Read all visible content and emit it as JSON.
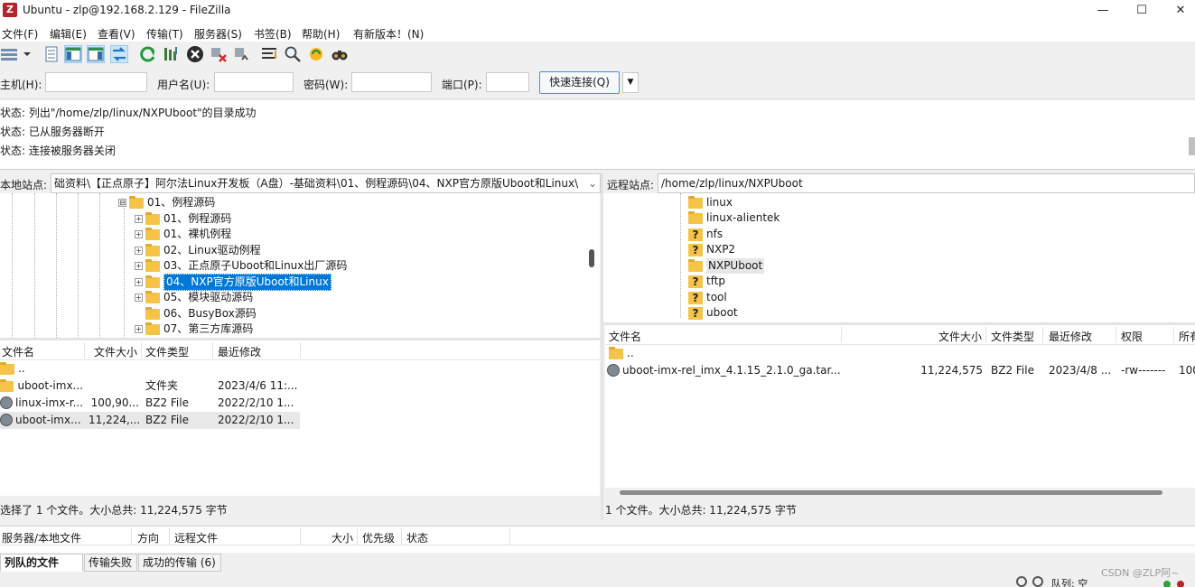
{
  "window": {
    "title": "Ubuntu - zlp@192.168.2.129 - FileZilla",
    "app_icon": "Z",
    "minimize": "—",
    "maximize": "☐",
    "close": "✕"
  },
  "menu": [
    "文件(F)",
    "编辑(E)",
    "查看(V)",
    "传输(T)",
    "服务器(S)",
    "书签(B)",
    "帮助(H)",
    "有新版本！(N)"
  ],
  "quickconnect": {
    "host_label": "主机(H):",
    "user_label": "用户名(U):",
    "pass_label": "密码(W):",
    "port_label": "端口(P):",
    "host": "",
    "user": "",
    "pass": "",
    "port": "",
    "button": "快速连接(Q)",
    "dropdown": "▼"
  },
  "log": [
    "状态:  列出\"/home/zlp/linux/NXPUboot\"的目录成功",
    "状态:  已从服务器断开",
    "状态:  连接被服务器关闭"
  ],
  "local": {
    "site_label": "本地站点:",
    "path": "础资料\\【正点原子】阿尔法Linux开发板（A盘）-基础资料\\01、例程源码\\04、NXP官方原版Uboot和Linux\\",
    "tree": [
      {
        "label": "01、例程源码",
        "expander": "⊟"
      },
      {
        "label": "01、例程源码",
        "expander": "+"
      },
      {
        "label": "01、裸机例程",
        "expander": "+"
      },
      {
        "label": "02、Linux驱动例程",
        "expander": "+"
      },
      {
        "label": "03、正点原子Uboot和Linux出厂源码",
        "expander": "+"
      },
      {
        "label": "04、NXP官方原版Uboot和Linux",
        "expander": "+",
        "selected": true
      },
      {
        "label": "05、模块驱动源码",
        "expander": "+"
      },
      {
        "label": "06、BusyBox源码",
        "expander": ""
      },
      {
        "label": "07、第三方库源码",
        "expander": "+"
      }
    ],
    "headers": [
      "文件名",
      "文件大小",
      "文件类型",
      "最近修改"
    ],
    "sort_arrow": "^",
    "files": [
      {
        "name": "..",
        "size": "",
        "type": "",
        "modified": "",
        "icon": "folder-icon"
      },
      {
        "name": "uboot-imx...",
        "size": "",
        "type": "文件夹",
        "modified": "2023/4/6 11:...",
        "icon": "folder-icon"
      },
      {
        "name": "linux-imx-r...",
        "size": "100,90...",
        "type": "BZ2 File",
        "modified": "2022/2/10 1...",
        "icon": "archive-icon"
      },
      {
        "name": "uboot-imx...",
        "size": "11,224,...",
        "type": "BZ2 File",
        "modified": "2022/2/10 1...",
        "icon": "archive-icon",
        "selected": true
      }
    ],
    "status": "选择了 1 个文件。大小总共: 11,224,575 字节"
  },
  "remote": {
    "site_label": "远程站点:",
    "path": "/home/zlp/linux/NXPUboot",
    "tree": [
      {
        "label": "linux",
        "icon": "folder"
      },
      {
        "label": "linux-alientek",
        "icon": "folder"
      },
      {
        "label": "nfs",
        "icon": "unknown"
      },
      {
        "label": "NXP2",
        "icon": "unknown"
      },
      {
        "label": "NXPUboot",
        "icon": "folder",
        "selected": true
      },
      {
        "label": "tftp",
        "icon": "unknown"
      },
      {
        "label": "tool",
        "icon": "unknown"
      },
      {
        "label": "uboot",
        "icon": "unknown"
      }
    ],
    "headers": [
      "文件名",
      "文件大小",
      "文件类型",
      "最近修改",
      "权限",
      "所有"
    ],
    "sort_arrow": "^",
    "files": [
      {
        "name": "..",
        "size": "",
        "type": "",
        "modified": "",
        "perms": "",
        "owner": "",
        "icon": "folder-icon"
      },
      {
        "name": "uboot-imx-rel_imx_4.1.15_2.1.0_ga.tar....",
        "size": "11,224,575",
        "type": "BZ2 File",
        "modified": "2023/4/8 ...",
        "perms": "-rw-------",
        "owner": "100",
        "icon": "archive-icon"
      }
    ],
    "status": "1 个文件。大小总共: 11,224,575 字节"
  },
  "queue": {
    "headers": [
      "服务器/本地文件",
      "方向",
      "远程文件",
      "大小",
      "优先级",
      "状态"
    ]
  },
  "tabs": [
    "列队的文件",
    "传输失败",
    "成功的传输 (6)"
  ],
  "bottom": {
    "queue_status": "队列: 空",
    "watermark": "CSDN @ZLP阿~"
  },
  "colors": {
    "selection": "#0078d7",
    "accent": "#4a90d9"
  }
}
